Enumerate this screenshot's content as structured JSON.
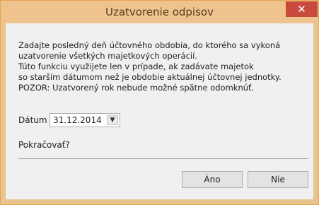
{
  "window": {
    "title": "Uzatvorenie odpisov",
    "close_glyph": "✕"
  },
  "message": {
    "lines": [
      "Zadajte posledný deň účtovného obdobia, do ktorého sa vykoná",
      "uzatvorenie všetkých majetkových operácií.",
      "Túto funkciu využijete len v prípade, ak zadávate majetok",
      "so starším dátumom než je obdobie aktuálnej účtovnej jednotky.",
      "POZOR: Uzatvorený rok nebude možné spätne odomknúť."
    ]
  },
  "date_field": {
    "label": "Dátum",
    "value": "31.12.2014",
    "arrow_glyph": "▼"
  },
  "question": "Pokračovať?",
  "buttons": {
    "yes": "Áno",
    "no": "Nie"
  }
}
